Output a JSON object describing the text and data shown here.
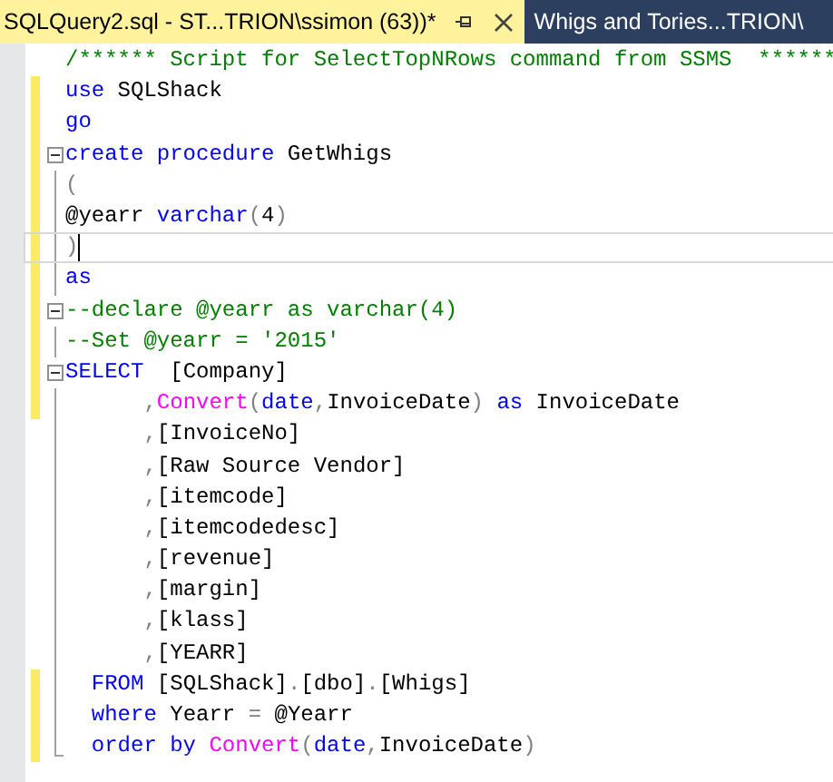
{
  "tabs": [
    {
      "title": "SQLQuery2.sql - ST...TRION\\ssimon (63))*",
      "selected": true
    },
    {
      "title": "Whigs and Tories...TRION\\",
      "selected": false
    }
  ],
  "editor": {
    "lines": [
      {
        "tokens": [
          {
            "text": "/****** Script for SelectTopNRows command from SSMS  ******",
            "kind": "comment"
          }
        ],
        "changed": false,
        "collapse": false,
        "current": false
      },
      {
        "tokens": [
          {
            "text": "use",
            "kind": "keyword"
          },
          {
            "text": " SQLShack",
            "kind": "plain"
          }
        ],
        "changed": true,
        "collapse": false,
        "current": false
      },
      {
        "tokens": [
          {
            "text": "go",
            "kind": "keyword"
          }
        ],
        "changed": true,
        "collapse": false,
        "current": false
      },
      {
        "tokens": [
          {
            "text": "create procedure",
            "kind": "keyword"
          },
          {
            "text": " GetWhigs",
            "kind": "plain"
          }
        ],
        "changed": true,
        "collapse": true,
        "current": false
      },
      {
        "tokens": [
          {
            "text": "(",
            "kind": "punct"
          }
        ],
        "changed": true,
        "collapse": false,
        "current": false
      },
      {
        "tokens": [
          {
            "text": "@yearr ",
            "kind": "plain"
          },
          {
            "text": "varchar",
            "kind": "keyword"
          },
          {
            "text": "(",
            "kind": "punct"
          },
          {
            "text": "4",
            "kind": "plain"
          },
          {
            "text": ")",
            "kind": "punct"
          }
        ],
        "changed": true,
        "collapse": false,
        "current": false
      },
      {
        "tokens": [
          {
            "text": ")",
            "kind": "punct"
          }
        ],
        "changed": true,
        "collapse": false,
        "current": true
      },
      {
        "tokens": [
          {
            "text": "as",
            "kind": "keyword"
          }
        ],
        "changed": true,
        "collapse": false,
        "current": false
      },
      {
        "tokens": [
          {
            "text": "--declare @yearr as varchar(4)",
            "kind": "comment"
          }
        ],
        "changed": true,
        "collapse": true,
        "current": false
      },
      {
        "tokens": [
          {
            "text": "--Set @yearr = '2015'",
            "kind": "comment"
          }
        ],
        "changed": true,
        "collapse": false,
        "current": false
      },
      {
        "tokens": [
          {
            "text": "SELECT",
            "kind": "keyword"
          },
          {
            "text": "  [Company]",
            "kind": "plain"
          }
        ],
        "changed": true,
        "collapse": true,
        "current": false
      },
      {
        "tokens": [
          {
            "text": "      ,",
            "kind": "punct"
          },
          {
            "text": "Convert",
            "kind": "function"
          },
          {
            "text": "(",
            "kind": "punct"
          },
          {
            "text": "date",
            "kind": "keyword"
          },
          {
            "text": ",",
            "kind": "punct"
          },
          {
            "text": "InvoiceDate",
            "kind": "plain"
          },
          {
            "text": ") ",
            "kind": "punct"
          },
          {
            "text": "as",
            "kind": "keyword"
          },
          {
            "text": " InvoiceDate",
            "kind": "plain"
          }
        ],
        "changed": true,
        "collapse": false,
        "current": false
      },
      {
        "tokens": [
          {
            "text": "      ,",
            "kind": "punct"
          },
          {
            "text": "[InvoiceNo]",
            "kind": "plain"
          }
        ],
        "changed": false,
        "collapse": false,
        "current": false
      },
      {
        "tokens": [
          {
            "text": "      ,",
            "kind": "punct"
          },
          {
            "text": "[Raw Source Vendor]",
            "kind": "plain"
          }
        ],
        "changed": false,
        "collapse": false,
        "current": false
      },
      {
        "tokens": [
          {
            "text": "      ,",
            "kind": "punct"
          },
          {
            "text": "[itemcode]",
            "kind": "plain"
          }
        ],
        "changed": false,
        "collapse": false,
        "current": false
      },
      {
        "tokens": [
          {
            "text": "      ,",
            "kind": "punct"
          },
          {
            "text": "[itemcodedesc]",
            "kind": "plain"
          }
        ],
        "changed": false,
        "collapse": false,
        "current": false
      },
      {
        "tokens": [
          {
            "text": "      ,",
            "kind": "punct"
          },
          {
            "text": "[revenue]",
            "kind": "plain"
          }
        ],
        "changed": false,
        "collapse": false,
        "current": false
      },
      {
        "tokens": [
          {
            "text": "      ,",
            "kind": "punct"
          },
          {
            "text": "[margin]",
            "kind": "plain"
          }
        ],
        "changed": false,
        "collapse": false,
        "current": false
      },
      {
        "tokens": [
          {
            "text": "      ,",
            "kind": "punct"
          },
          {
            "text": "[klass]",
            "kind": "plain"
          }
        ],
        "changed": false,
        "collapse": false,
        "current": false
      },
      {
        "tokens": [
          {
            "text": "      ,",
            "kind": "punct"
          },
          {
            "text": "[YEARR]",
            "kind": "plain"
          }
        ],
        "changed": false,
        "collapse": false,
        "current": false
      },
      {
        "tokens": [
          {
            "text": "  FROM",
            "kind": "keyword"
          },
          {
            "text": " [SQLShack]",
            "kind": "plain"
          },
          {
            "text": ".",
            "kind": "punct"
          },
          {
            "text": "[dbo]",
            "kind": "plain"
          },
          {
            "text": ".",
            "kind": "punct"
          },
          {
            "text": "[Whigs]",
            "kind": "plain"
          }
        ],
        "changed": true,
        "collapse": false,
        "current": false
      },
      {
        "tokens": [
          {
            "text": "  where",
            "kind": "keyword"
          },
          {
            "text": " Yearr ",
            "kind": "plain"
          },
          {
            "text": "=",
            "kind": "punct"
          },
          {
            "text": " @Yearr",
            "kind": "plain"
          }
        ],
        "changed": true,
        "collapse": false,
        "current": false
      },
      {
        "tokens": [
          {
            "text": "  order by ",
            "kind": "keyword"
          },
          {
            "text": "Convert",
            "kind": "function"
          },
          {
            "text": "(",
            "kind": "punct"
          },
          {
            "text": "date",
            "kind": "keyword"
          },
          {
            "text": ",",
            "kind": "punct"
          },
          {
            "text": "InvoiceDate",
            "kind": "plain"
          },
          {
            "text": ")",
            "kind": "punct"
          }
        ],
        "changed": true,
        "collapse": false,
        "current": false
      }
    ]
  }
}
